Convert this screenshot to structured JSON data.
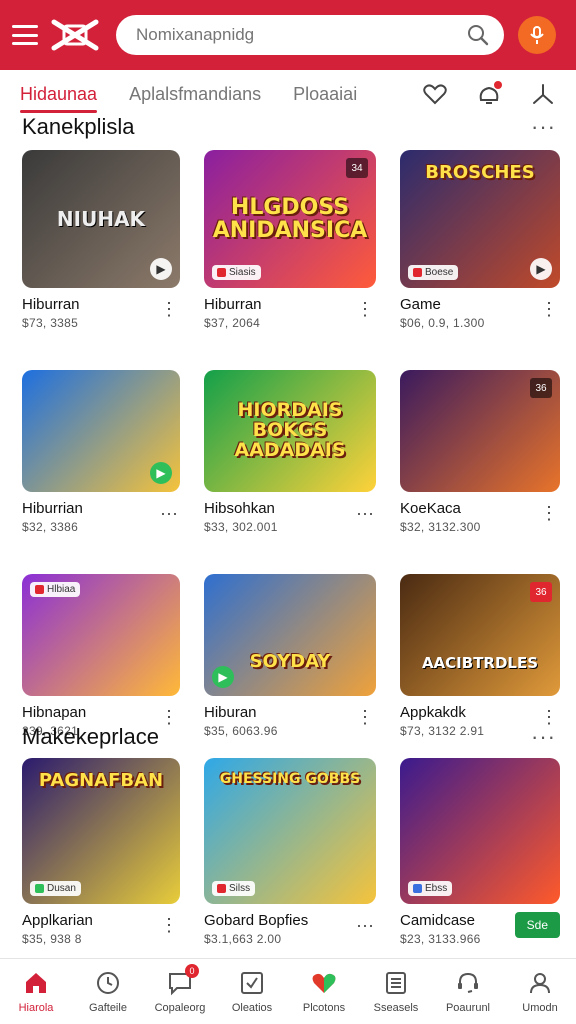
{
  "header": {
    "search_placeholder": "Nomixanapnidg"
  },
  "tabs": [
    {
      "label": "Hidaunaa",
      "active": true
    },
    {
      "label": "Aplalsfmandians",
      "active": false
    },
    {
      "label": "Ploaaiai",
      "active": false
    }
  ],
  "sections": [
    {
      "title": "Kanekplisla"
    },
    {
      "title": "Makekeprlace"
    }
  ],
  "cards": [
    {
      "thumb_text": "NIUHAK",
      "name": "Hiburran",
      "price": "$73, 3385",
      "badge": "",
      "colors": [
        "#3a3a3a",
        "#8c7a6a"
      ]
    },
    {
      "thumb_text": "HLGDOSS ANIDANSICA",
      "name": "Hiburran",
      "price": "$37, 2064",
      "badge": "Siasis",
      "colors": [
        "#8a1fa0",
        "#ff5b3a"
      ]
    },
    {
      "thumb_text": "BROSCHES",
      "name": "Game",
      "price": "$06, 0.9, 1.300",
      "badge": "Boese",
      "colors": [
        "#2b2b6e",
        "#c04a2a"
      ]
    },
    {
      "thumb_text": "",
      "name": "Hiburrian",
      "price": "$32, 3386",
      "badge": "",
      "colors": [
        "#1d6fe0",
        "#f5c33b"
      ]
    },
    {
      "thumb_text": "HIORDAIS BOKGS AADADAIS",
      "name": "Hibsohkan",
      "price": "$33, 302.001",
      "badge": "",
      "colors": [
        "#13a04a",
        "#ffd23a"
      ]
    },
    {
      "thumb_text": "",
      "name": "KoeKaca",
      "price": "$32, 3132.300",
      "badge": "",
      "colors": [
        "#3a1a5e",
        "#e8742a"
      ]
    },
    {
      "thumb_text": "",
      "name": "Hibnapan",
      "price": "239, 3621",
      "badge": "Hlbiaa",
      "colors": [
        "#8b2fd6",
        "#ffb938"
      ]
    },
    {
      "thumb_text": "SOYDAY",
      "name": "Hiburan",
      "price": "$35, 6063.96",
      "badge": "",
      "colors": [
        "#2e6fd0",
        "#f0a23a"
      ]
    },
    {
      "thumb_text": "AACIBTRDLES",
      "name": "Appkakdk",
      "price": "$73, 3132 2.91",
      "badge": "",
      "colors": [
        "#4a2a12",
        "#e09a3a"
      ]
    },
    {
      "thumb_text": "PAGNAFBAN",
      "name": "Applkarian",
      "price": "$35, 938 8",
      "badge": "Dusan",
      "colors": [
        "#2a1a6e",
        "#e8cd3a"
      ]
    },
    {
      "thumb_text": "GHESSING GOBBS",
      "name": "Gobard Bopfies",
      "price": "$3.1,663 2.00",
      "badge": "Silss",
      "colors": [
        "#2ea8e8",
        "#f5c33b"
      ]
    },
    {
      "thumb_text": "",
      "name": "Camidcase",
      "price": "$23, 3133.966",
      "badge": "Ebss",
      "colors": [
        "#3a1a8e",
        "#ff5a2a"
      ],
      "install_label": "Sde"
    }
  ],
  "bottom_nav": [
    {
      "label": "Hiarola",
      "icon": "home-icon",
      "active": true
    },
    {
      "label": "Gafteile",
      "icon": "clock-icon",
      "active": false
    },
    {
      "label": "Copaleorg",
      "icon": "chat-icon",
      "active": false,
      "badge": "0"
    },
    {
      "label": "Oleatios",
      "icon": "check-icon",
      "active": false
    },
    {
      "label": "Plcotons",
      "icon": "heart-icon",
      "active": false
    },
    {
      "label": "Sseasels",
      "icon": "list-icon",
      "active": false
    },
    {
      "label": "Poaurunl",
      "icon": "headset-icon",
      "active": false
    },
    {
      "label": "Umodn",
      "icon": "user-icon",
      "active": false
    }
  ],
  "colors": {
    "brand": "#d3213a",
    "accent": "#f26a23",
    "install": "#1d9a45"
  }
}
